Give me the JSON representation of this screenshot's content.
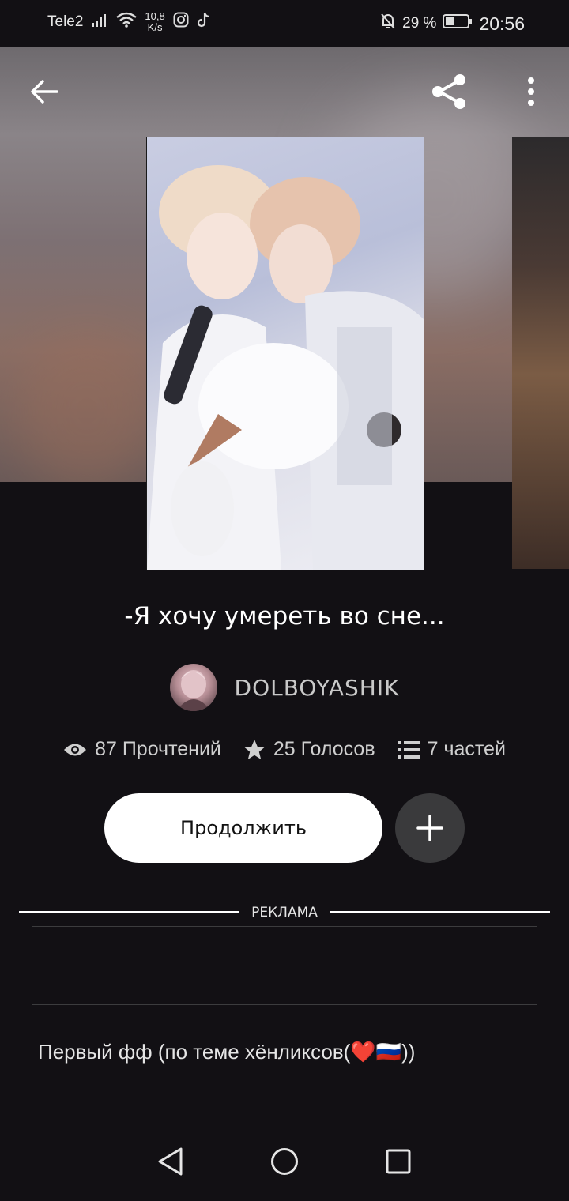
{
  "status_bar": {
    "carrier": "Tele2",
    "net_speed_value": "10,8",
    "net_speed_unit": "K/s",
    "battery": "29 %",
    "time": "20:56",
    "icons": [
      "signal-icon",
      "wifi-icon",
      "instagram-icon",
      "tiktok-icon",
      "mute-bell-icon",
      "battery-icon"
    ]
  },
  "toolbar": {
    "icons": [
      "back-arrow-icon",
      "share-icon",
      "more-vertical-icon"
    ]
  },
  "story": {
    "title": "-Я хочу умереть во сне...",
    "author": "DOLBOYASHIK",
    "stats": {
      "reads": "87 Прочтений",
      "votes": "25 Голосов",
      "parts": "7 частей"
    },
    "continue_label": "Продолжить",
    "description": "Первый фф (по теме хёнликсов(❤️🇷🇺))"
  },
  "ad": {
    "label": "РЕКЛАМА"
  },
  "colors": {
    "background": "#121014",
    "primary_button": "#ffffff",
    "secondary_button": "#3a3a3c"
  }
}
